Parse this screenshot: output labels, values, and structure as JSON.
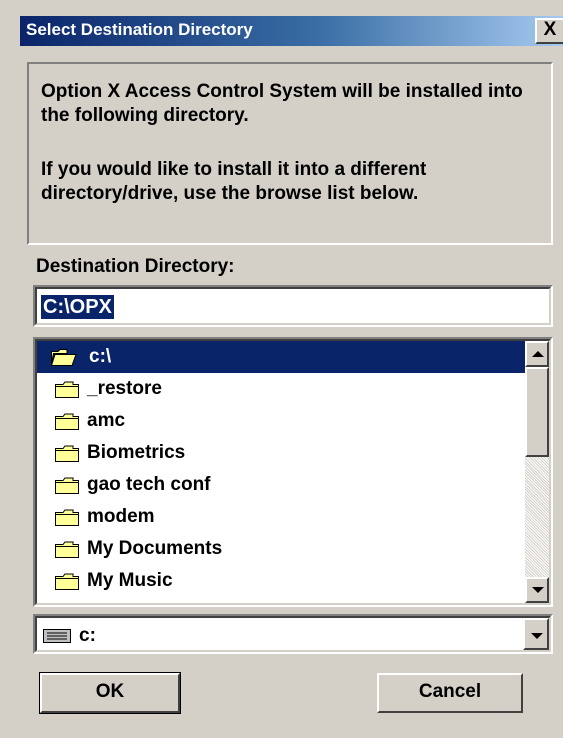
{
  "window": {
    "title": "Select Destination Directory",
    "close_glyph": "X"
  },
  "info": {
    "line1": "Option X Access Control System  will be installed into the following directory.",
    "line2": "If you would like to install it into a different directory/drive, use the browse list below."
  },
  "destination": {
    "label": "Destination Directory:",
    "path_value": "C:\\OPX"
  },
  "directory_list": {
    "items": [
      {
        "label": "c:\\",
        "icon": "open-folder-icon",
        "selected": true
      },
      {
        "label": "_restore",
        "icon": "folder-icon"
      },
      {
        "label": "amc",
        "icon": "folder-icon"
      },
      {
        "label": "Biometrics",
        "icon": "folder-icon"
      },
      {
        "label": "gao tech conf",
        "icon": "folder-icon"
      },
      {
        "label": "modem",
        "icon": "folder-icon"
      },
      {
        "label": "My Documents",
        "icon": "folder-icon"
      },
      {
        "label": "My Music",
        "icon": "folder-icon"
      }
    ]
  },
  "drive": {
    "selected": "c:",
    "icon": "hard-drive-icon"
  },
  "buttons": {
    "ok": "OK",
    "cancel": "Cancel"
  },
  "colors": {
    "face": "#d4d0c8",
    "selection": "#0a246a",
    "title_gradient_start": "#0a246a",
    "title_gradient_end": "#a6caf0"
  }
}
